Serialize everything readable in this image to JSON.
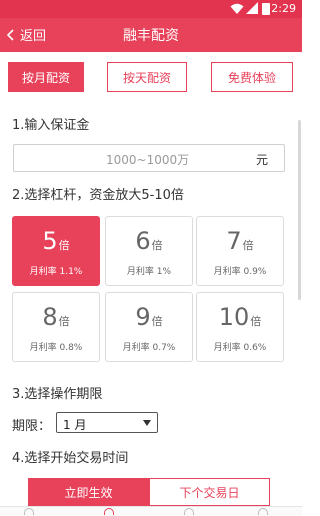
{
  "status_bar": {
    "time": "2:29"
  },
  "nav": {
    "back_label": "返回",
    "title": "融丰配资"
  },
  "tabs": [
    {
      "label": "按月配资",
      "active": true
    },
    {
      "label": "按天配资",
      "active": false
    },
    {
      "label": "免费体验",
      "active": false
    }
  ],
  "step1": {
    "label": "1.输入保证金",
    "placeholder": "1000~1000万",
    "unit": "元"
  },
  "step2": {
    "label": "2.选择杠杆，资金放大5-10倍",
    "multiplier_unit": "倍",
    "options": [
      {
        "value": "5",
        "rate": "月利率 1.1%",
        "selected": true
      },
      {
        "value": "6",
        "rate": "月利率 1%",
        "selected": false
      },
      {
        "value": "7",
        "rate": "月利率 0.9%",
        "selected": false
      },
      {
        "value": "8",
        "rate": "月利率 0.8%",
        "selected": false
      },
      {
        "value": "9",
        "rate": "月利率 0.7%",
        "selected": false
      },
      {
        "value": "10",
        "rate": "月利率 0.6%",
        "selected": false
      }
    ]
  },
  "step3": {
    "label": "3.选择操作期限",
    "period_label": "期限：",
    "period_value": "1 月"
  },
  "step4": {
    "label": "4.选择开始交易时间",
    "options": [
      "立即生效",
      "下个交易日"
    ]
  },
  "colors": {
    "accent": "#e8415a",
    "status_bar": "#e2344f"
  },
  "icons": [
    "wifi-icon",
    "signal-icon",
    "battery-icon",
    "chevron-left-icon",
    "dropdown-arrow-icon"
  ]
}
